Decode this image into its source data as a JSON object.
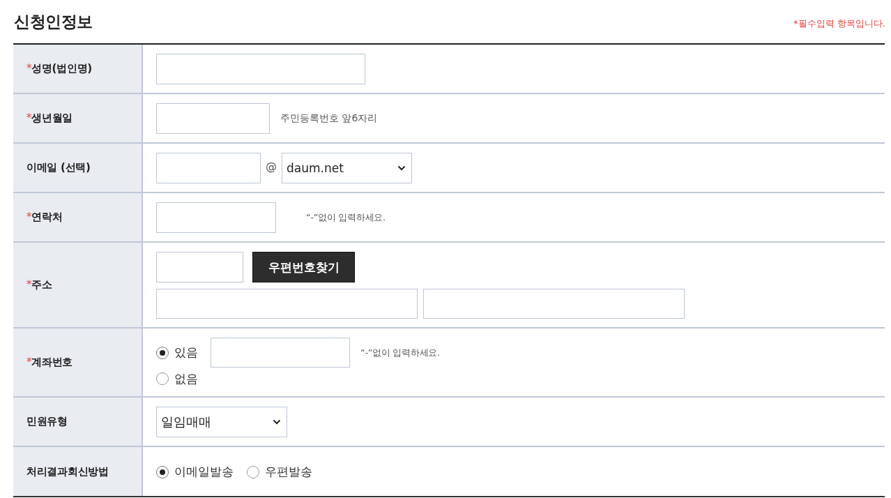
{
  "header": {
    "title": "신청인정보",
    "required_note": "*필수입력 항목입니다."
  },
  "form_rows": [
    {
      "kind": "name",
      "mark": "*",
      "label": "성명(법인명)"
    },
    {
      "kind": "birthdate",
      "mark": "*",
      "label": "생년월일",
      "hint": "주민등록번호 앞6자리"
    },
    {
      "kind": "email",
      "label": "이메일 (선택)",
      "separator": "@",
      "domain": "daum.net"
    },
    {
      "kind": "phone",
      "mark": "*",
      "label": "연락처",
      "hint": "“-”없이 입력하세요."
    },
    {
      "kind": "address",
      "mark": "*",
      "label": "주소",
      "button": "우편번호찾기"
    },
    {
      "kind": "account",
      "mark": "*",
      "label": "계좌번호",
      "options": [
        {
          "label": "있음",
          "selected": true
        },
        {
          "label": "없음",
          "selected": false
        }
      ],
      "hint": "“-”없이 입력하세요."
    },
    {
      "kind": "dropdown",
      "label": "민원유형",
      "value": "일임매매"
    },
    {
      "kind": "choice",
      "label": "처리결과회신방법",
      "options": [
        {
          "label": "이메일발송",
          "selected": true
        },
        {
          "label": "우편발송",
          "selected": false
        }
      ]
    }
  ]
}
